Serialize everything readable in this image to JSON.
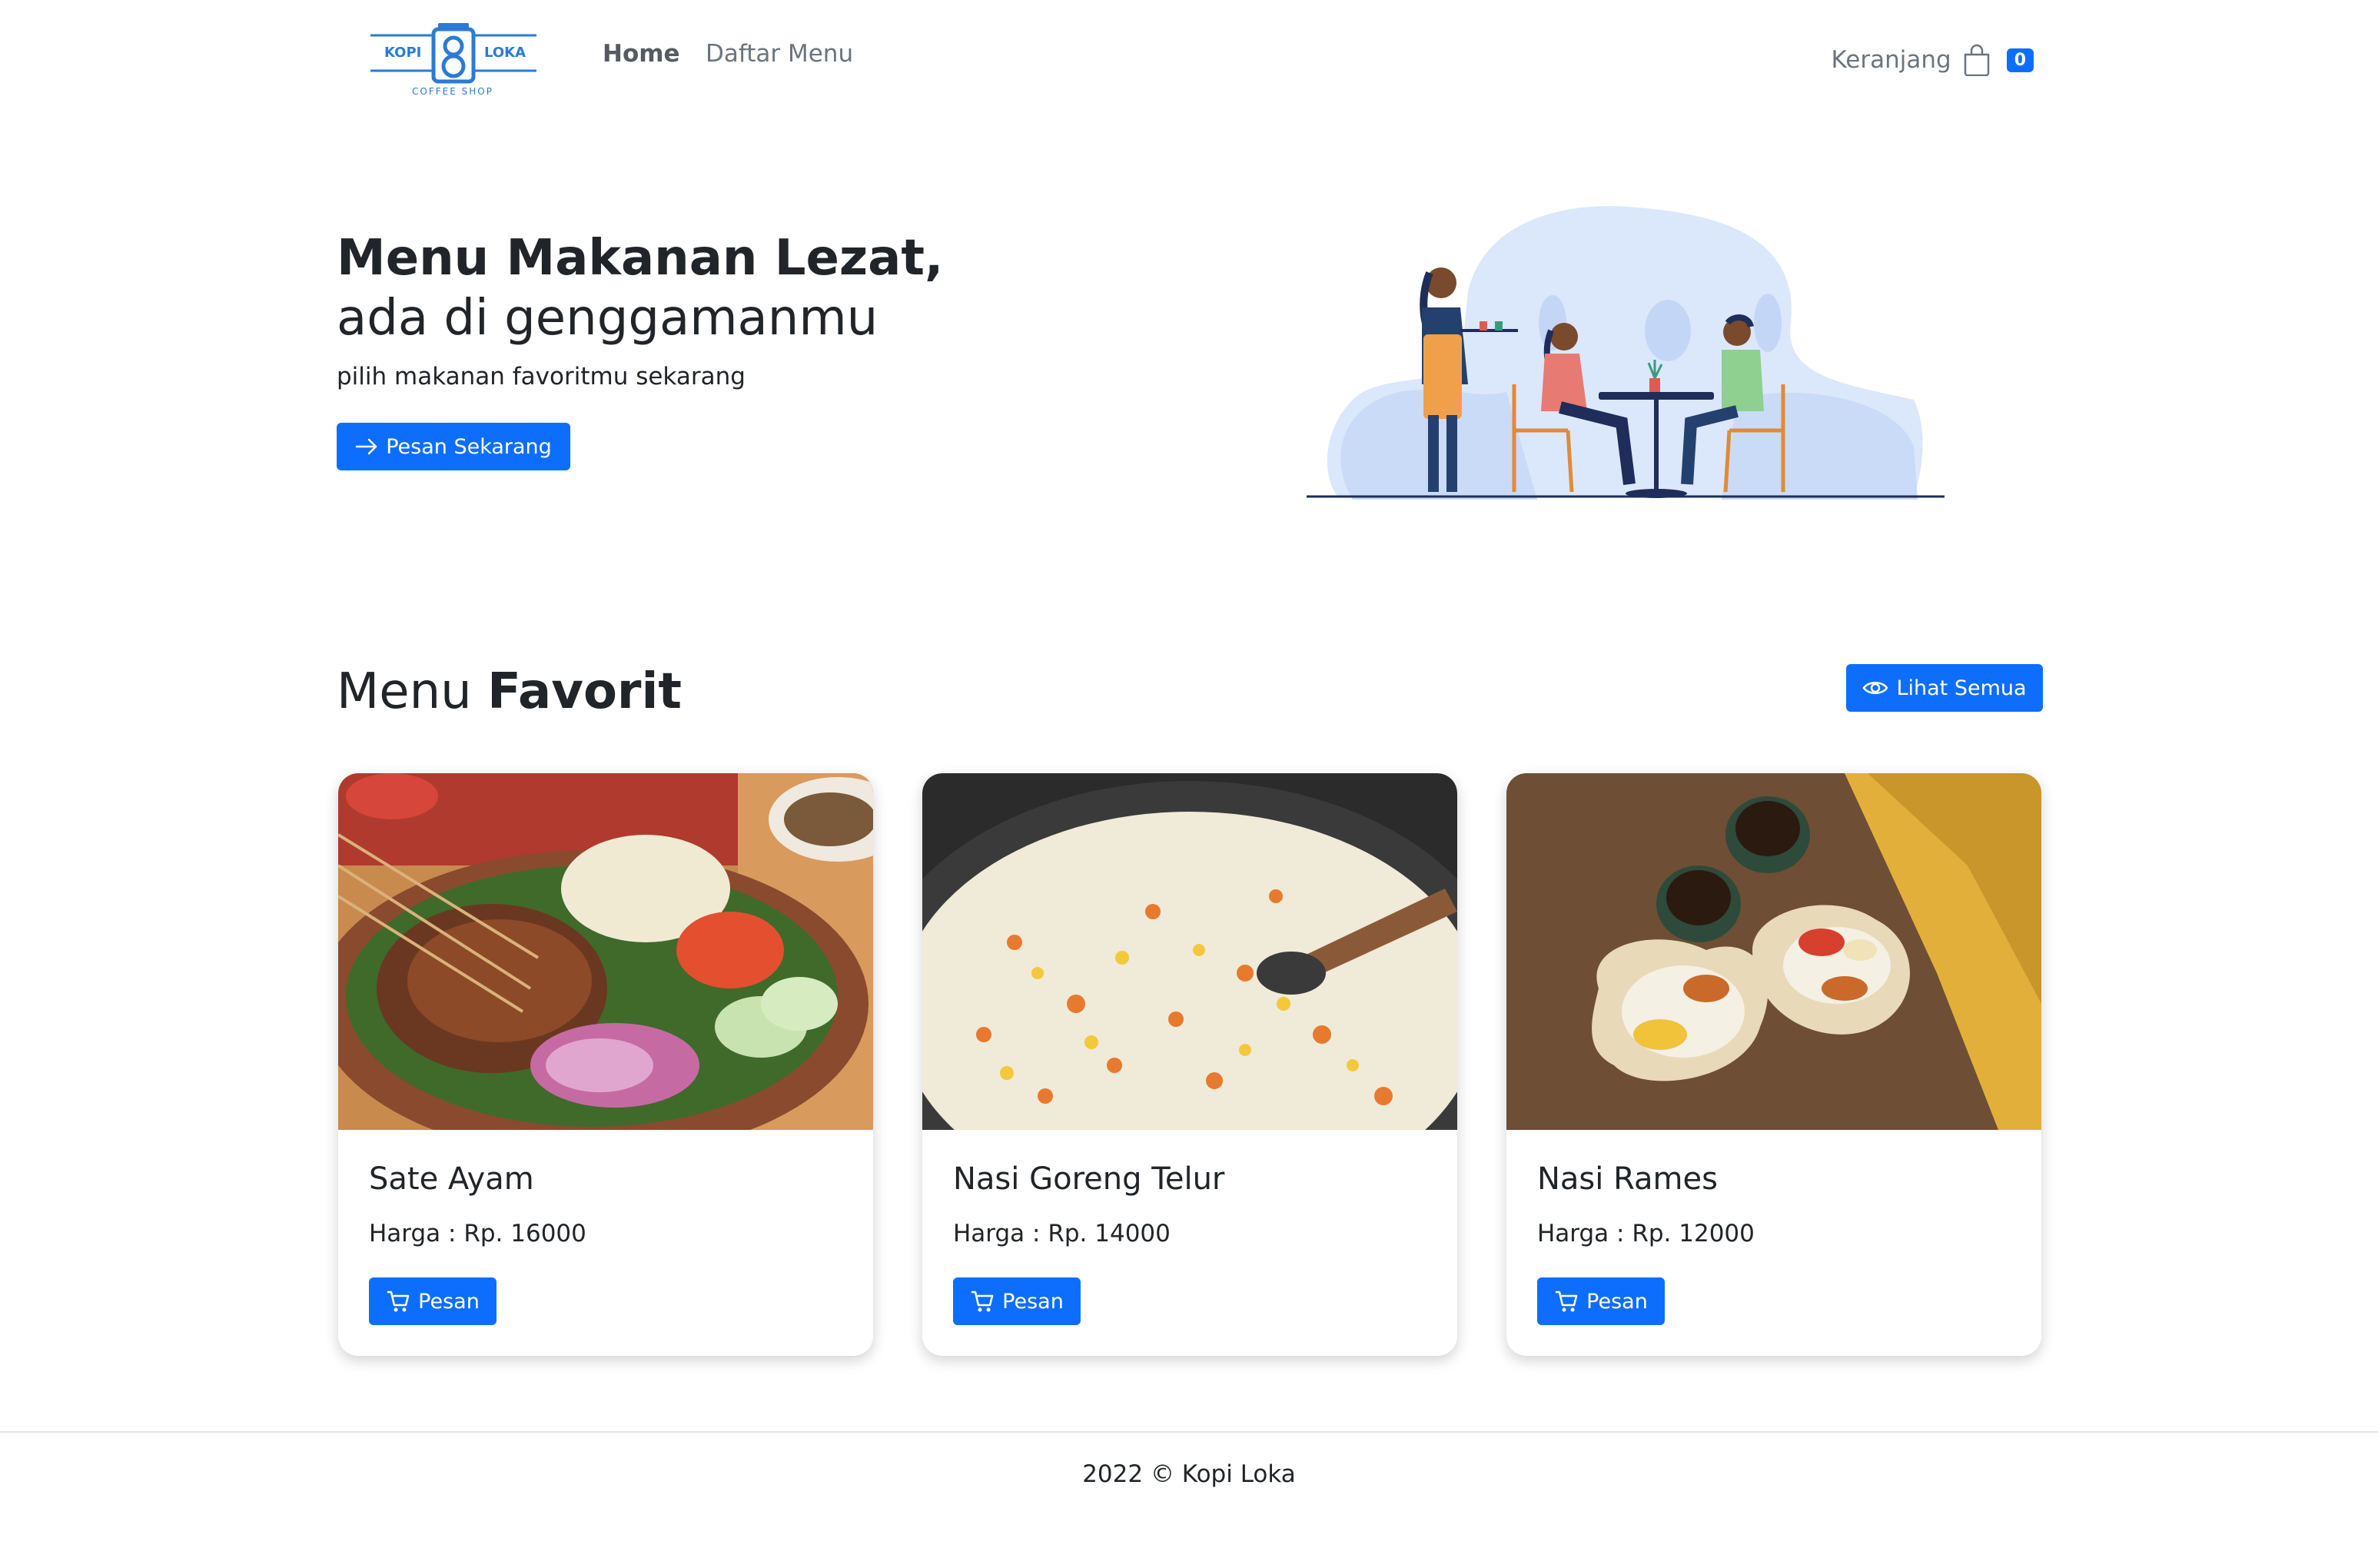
{
  "brand": {
    "logo_left": "KOPI",
    "logo_right": "LOKA",
    "logo_tagline": "COFFEE SHOP"
  },
  "nav": {
    "home": "Home",
    "menu": "Daftar Menu",
    "cart_label": "Keranjang",
    "cart_count": "0"
  },
  "hero": {
    "title_bold": "Menu Makanan Lezat,",
    "title_light": "ada di genggamanmu",
    "subtitle": "pilih makanan favoritmu sekarang",
    "cta": "Pesan Sekarang",
    "cta_icon": "arrow-right-icon"
  },
  "favorites": {
    "title_light": "Menu",
    "title_bold": "Favorit",
    "see_all": "Lihat Semua",
    "see_all_icon": "eye-icon",
    "items": [
      {
        "name": "Sate Ayam",
        "price": "Harga : Rp. 16000",
        "button": "Pesan"
      },
      {
        "name": "Nasi Goreng Telur",
        "price": "Harga : Rp. 14000",
        "button": "Pesan"
      },
      {
        "name": "Nasi Rames",
        "price": "Harga : Rp. 12000",
        "button": "Pesan"
      }
    ],
    "button_icon": "cart-icon"
  },
  "footer": {
    "text": "2022 © Kopi Loka"
  },
  "colors": {
    "primary": "#0d6efd",
    "text": "#212529",
    "muted": "#6c757d",
    "logo_blue": "#2b7bd6"
  }
}
